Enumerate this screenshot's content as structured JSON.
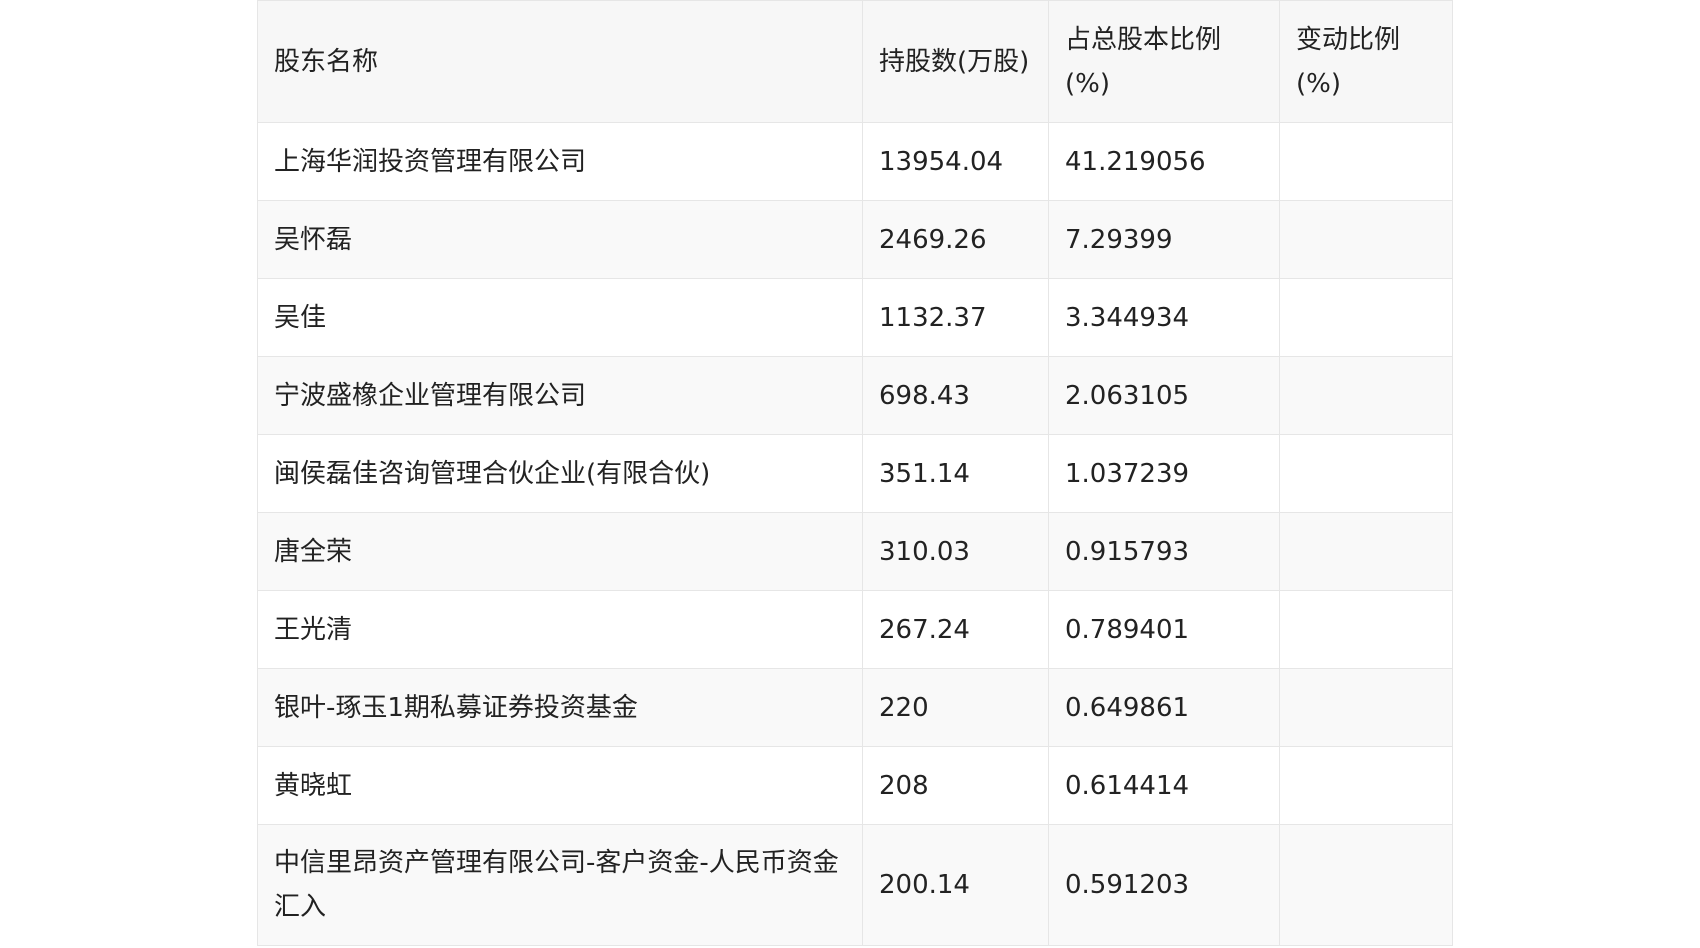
{
  "table": {
    "headers": [
      "股东名称",
      "持股数(万股)",
      "占总股本比例(%)",
      "变动比例(%)"
    ],
    "rows": [
      {
        "name": "上海华润投资管理有限公司",
        "shares": "13954.04",
        "ratio": "41.219056",
        "change": ""
      },
      {
        "name": "吴怀磊",
        "shares": "2469.26",
        "ratio": "7.29399",
        "change": ""
      },
      {
        "name": "吴佳",
        "shares": "1132.37",
        "ratio": "3.344934",
        "change": ""
      },
      {
        "name": "宁波盛橡企业管理有限公司",
        "shares": "698.43",
        "ratio": "2.063105",
        "change": ""
      },
      {
        "name": "闽侯磊佳咨询管理合伙企业(有限合伙)",
        "shares": "351.14",
        "ratio": "1.037239",
        "change": ""
      },
      {
        "name": "唐全荣",
        "shares": "310.03",
        "ratio": "0.915793",
        "change": ""
      },
      {
        "name": "王光清",
        "shares": "267.24",
        "ratio": "0.789401",
        "change": ""
      },
      {
        "name": "银叶-琢玉1期私募证券投资基金",
        "shares": "220",
        "ratio": "0.649861",
        "change": ""
      },
      {
        "name": "黄晓虹",
        "shares": "208",
        "ratio": "0.614414",
        "change": ""
      },
      {
        "name": "中信里昂资产管理有限公司-客户资金-人民币资金汇入",
        "shares": "200.14",
        "ratio": "0.591203",
        "change": ""
      }
    ]
  }
}
